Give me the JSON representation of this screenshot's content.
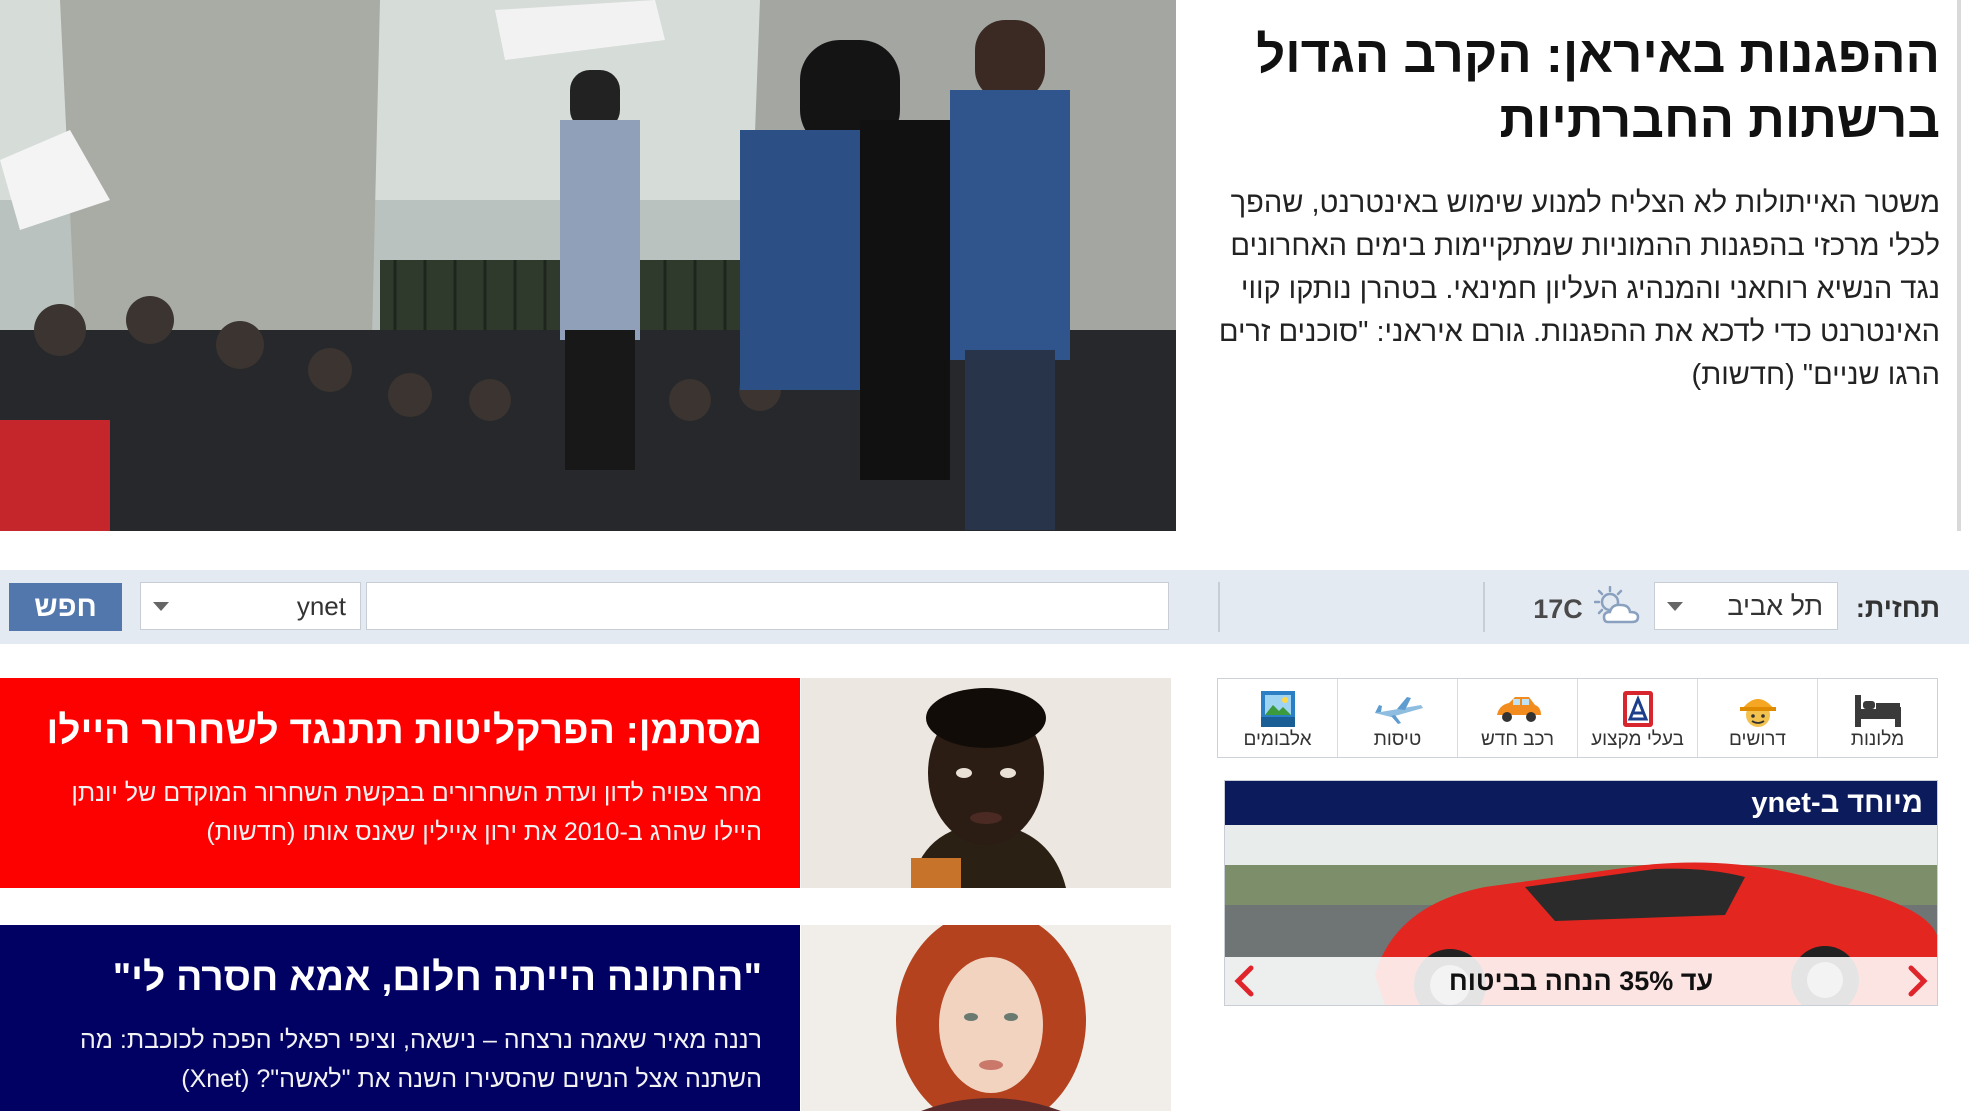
{
  "top_story": {
    "headline": "ההפגנות באיראן: הקרב הגדול ברשתות החברתיות",
    "summary": "משטר האייתולות לא הצליח למנוע שימוש באינטרנט, שהפך לכלי מרכזי בהפגנות ההמוניות שמתקיימות בימים האחרונים נגד הנשיא רוחאני והמנהיג העליון חמינאי. בטהרן נותקו קווי האינטרנט כדי לדכא את ההפגנות. גורם איראני: \"סוכנים זרים הרגו שניים\" (חדשות)"
  },
  "search_bar": {
    "button_label": "חפש",
    "site_value": "ynet",
    "query": "",
    "forecast_label": "תחזית:",
    "city": "תל אביב",
    "temperature": "17C",
    "weather_icon": "partly-cloudy-sun-icon"
  },
  "stories": [
    {
      "title": "מסתמן: הפרקליטות תתנגד לשחרור היילו",
      "subtitle": "מחר צפויה לדון ועדת השחרורים בבקשת השחרור המוקדם של יונתן היילו שהרג ב-2010 את ירון איילין שאנס אותו (חדשות)",
      "color": "#fd0000"
    },
    {
      "title": "\"החתונה הייתה חלום, אמא חסרה לי\"",
      "subtitle": "רננה מאיר שאמה נרצחה – נישאה, וציפי רפאלי הפכה לכוכבת: מה השתנה אצל הנשים שהסעירו השנה את \"לאשה\"? (Xnet)",
      "color": "#010164"
    }
  ],
  "services": [
    {
      "label": "מלונות",
      "icon": "bed-icon"
    },
    {
      "label": "דרושים",
      "icon": "worker-helmet-icon"
    },
    {
      "label": "בעלי מקצוע",
      "icon": "professionals-icon"
    },
    {
      "label": "רכב חדש",
      "icon": "car-icon"
    },
    {
      "label": "טיסות",
      "icon": "airplane-icon"
    },
    {
      "label": "אלבומים",
      "icon": "photo-album-icon"
    }
  ],
  "promo": {
    "header": "מיוחד ב-ynet",
    "caption": "עד 35% הנחה בביטוח",
    "accent": "#0c1b5c",
    "arrow_color": "#e0242b"
  }
}
